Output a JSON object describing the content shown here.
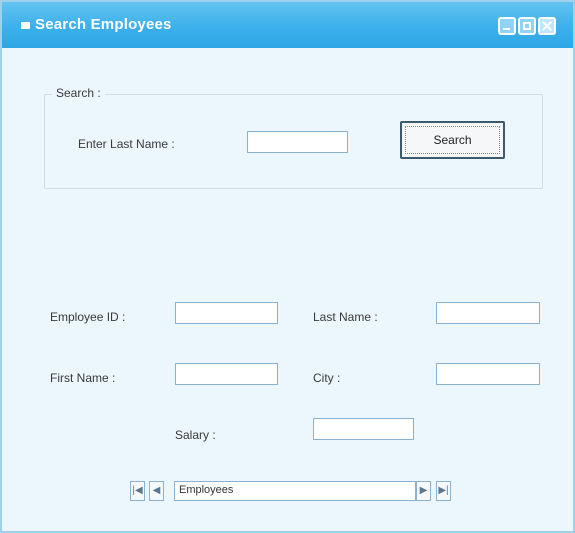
{
  "window": {
    "title": "Search Employees"
  },
  "search_group": {
    "label": "Search :",
    "last_name_label": "Enter Last Name :",
    "last_name_value": "",
    "search_button_label": "Search"
  },
  "fields": {
    "employee_id_label": "Employee ID :",
    "employee_id_value": "",
    "last_name_label": "Last Name :",
    "last_name_value": "",
    "first_name_label": "First Name :",
    "first_name_value": "",
    "city_label": "City :",
    "city_value": "",
    "salary_label": "Salary :",
    "salary_value": ""
  },
  "navigator": {
    "first_icon": "first-record-icon",
    "prev_icon": "previous-record-icon",
    "table_name": "Employees",
    "next_icon": "next-record-icon",
    "last_icon": "last-record-icon"
  }
}
